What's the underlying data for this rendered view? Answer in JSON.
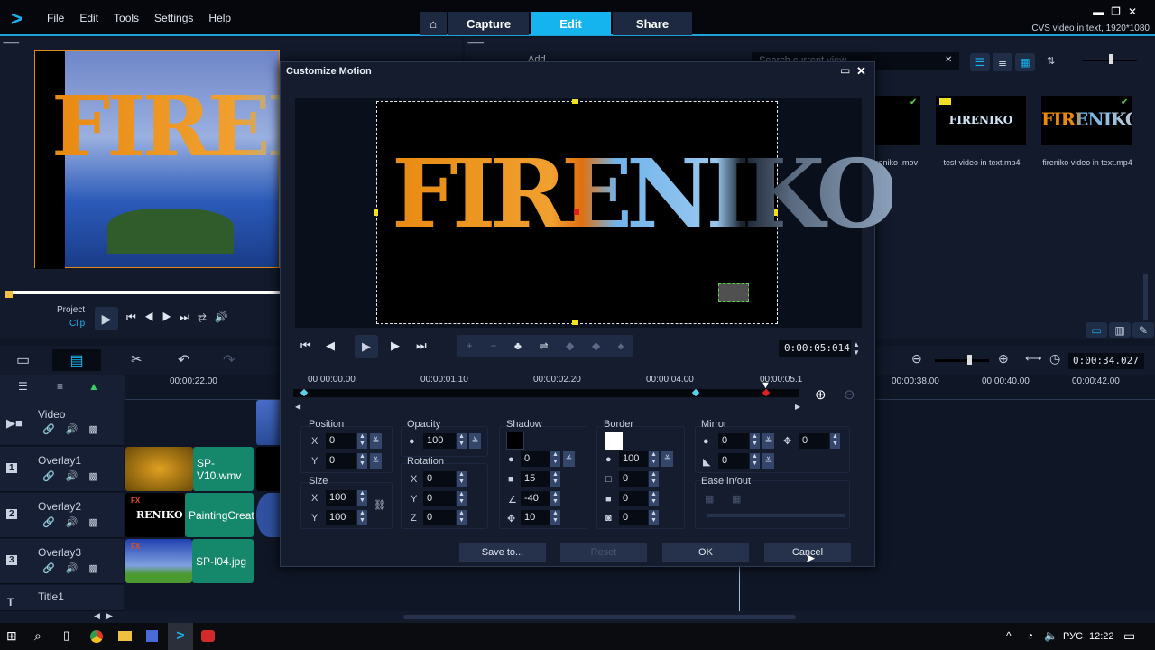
{
  "app": {
    "menu": [
      "File",
      "Edit",
      "Tools",
      "Settings",
      "Help"
    ],
    "tabs": [
      "Capture",
      "Edit",
      "Share"
    ],
    "active_tab": "Edit",
    "project_info": "CVS video in text, 1920*1080",
    "accent": "#16b4ee"
  },
  "preview": {
    "text": "FIRENIKO",
    "project_label": "Project",
    "clip_label": "Clip"
  },
  "library": {
    "add_label": "Add",
    "search_placeholder": "Search current view",
    "items": [
      {
        "name": "fireniko .mov",
        "thumb_text": ""
      },
      {
        "name": "test video in text.mp4",
        "thumb_text": "FIRENIKO"
      },
      {
        "name": "fireniko video in text.mp4",
        "thumb_text": "FIRENIKO"
      }
    ]
  },
  "timeline": {
    "timecode": "0:00:34.027",
    "ruler": [
      "00:00:22.00",
      "00:00:38.00",
      "00:00:40.00",
      "00:00:42.00"
    ],
    "tracks": [
      {
        "name": "Video",
        "icon": "video-track-icon"
      },
      {
        "name": "Overlay1",
        "icon": "overlay1-icon",
        "num": "1"
      },
      {
        "name": "Overlay2",
        "icon": "overlay2-icon",
        "num": "2"
      },
      {
        "name": "Overlay3",
        "icon": "overlay3-icon",
        "num": "3"
      },
      {
        "name": "Title1",
        "icon": "title-track-icon"
      }
    ],
    "clips": {
      "overlay1": "SP-V10.wmv",
      "overlay2": "PaintingCreato",
      "overlay3": "SP-I04.jpg",
      "overlay2_thumb": "RENIKO",
      "fx": "FX"
    }
  },
  "dialog": {
    "title": "Customize Motion",
    "canvas_text": "FIRENIKO",
    "timecode": "0:00:05:014",
    "ruler": [
      "00:00:00.00",
      "00:00:01.10",
      "00:00:02.20",
      "00:00:04.00",
      "00:00:05.1"
    ],
    "position": {
      "label": "Position",
      "x": "0",
      "y": "0"
    },
    "size": {
      "label": "Size",
      "x": "100",
      "y": "100"
    },
    "opacity": {
      "label": "Opacity",
      "value": "100"
    },
    "rotation": {
      "label": "Rotation",
      "x": "0",
      "y": "0",
      "z": "0"
    },
    "shadow": {
      "label": "Shadow",
      "color": "#000000",
      "opacity": "0",
      "blur": "15",
      "angle": "-40",
      "distance": "10"
    },
    "border": {
      "label": "Border",
      "color": "#ffffff",
      "opacity": "100",
      "width": "0",
      "blur": "0",
      "soft": "0"
    },
    "mirror": {
      "label": "Mirror",
      "opacity": "0",
      "offset": "0",
      "fade": "0"
    },
    "ease": {
      "label": "Ease in/out"
    },
    "axis": {
      "x": "X",
      "y": "Y",
      "z": "Z"
    },
    "buttons": {
      "save": "Save to...",
      "reset": "Reset",
      "ok": "OK",
      "cancel": "Cancel"
    }
  },
  "taskbar": {
    "lang": "РУС",
    "time": "12:22"
  }
}
